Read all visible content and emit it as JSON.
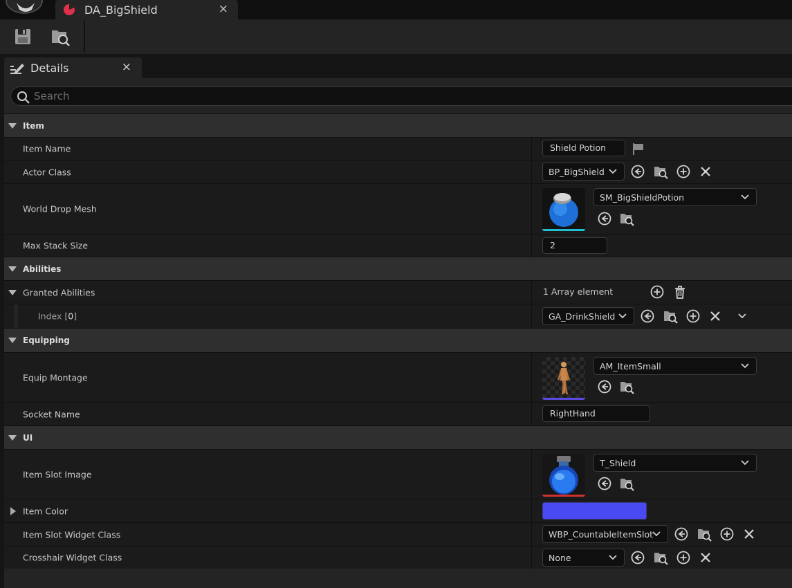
{
  "tab": {
    "title": "DA_BigShield",
    "close": "×"
  },
  "details": {
    "title": "Details",
    "close": "×"
  },
  "search": {
    "placeholder": "Search"
  },
  "categories": {
    "item": "Item",
    "abilities": "Abilities",
    "equipping": "Equipping",
    "ui": "UI"
  },
  "props": {
    "item_name": {
      "label": "Item Name",
      "value": "Shield Potion"
    },
    "actor_class": {
      "label": "Actor Class",
      "value": "BP_BigShield"
    },
    "world_drop_mesh": {
      "label": "World Drop Mesh",
      "value": "SM_BigShieldPotion"
    },
    "max_stack_size": {
      "label": "Max Stack Size",
      "value": "2"
    },
    "granted_abilities": {
      "label": "Granted Abilities",
      "value": "1 Array element"
    },
    "index0": {
      "label": "Index",
      "index": "0",
      "lb": "[",
      "rb": "]",
      "value": "GA_DrinkShield"
    },
    "equip_montage": {
      "label": "Equip Montage",
      "value": "AM_ItemSmall"
    },
    "socket_name": {
      "label": "Socket Name",
      "value": "RightHand"
    },
    "item_slot_image": {
      "label": "Item Slot Image",
      "value": "T_Shield"
    },
    "item_color": {
      "label": "Item Color",
      "color": "#4a4af2"
    },
    "item_slot_widget_class": {
      "label": "Item Slot Widget Class",
      "value": "WBP_CountableItemSlot"
    },
    "crosshair_widget_class": {
      "label": "Crosshair Widget Class",
      "value": "None"
    }
  },
  "icons": {
    "tab_asset": "data-asset-icon",
    "save": "save-icon",
    "browse": "browse-to-asset-icon",
    "use_selected": "use-selected-icon",
    "add": "add-icon",
    "clear": "clear-icon",
    "delete": "delete-icon",
    "flag": "localization-flag-icon"
  }
}
